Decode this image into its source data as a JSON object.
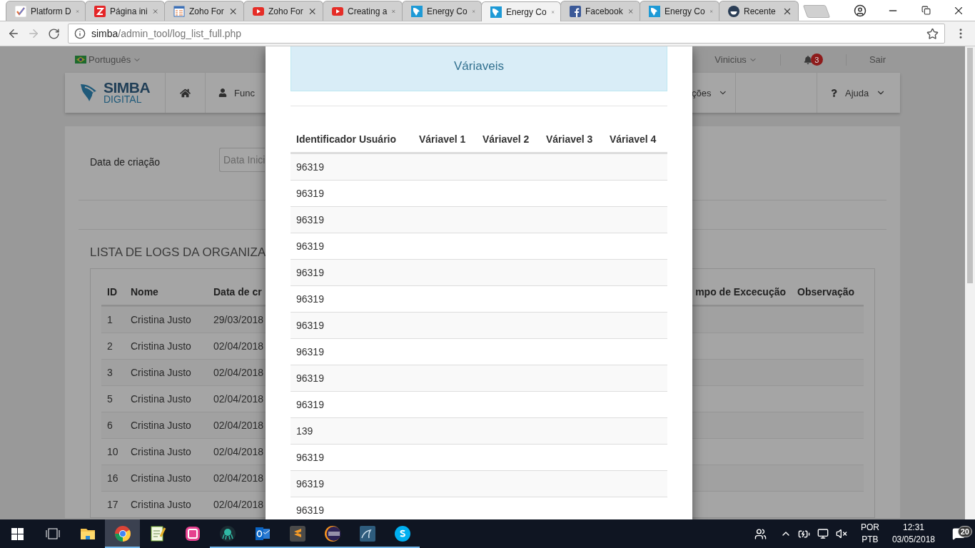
{
  "browser": {
    "tabs": [
      {
        "title": "Platform D",
        "kind": "check",
        "selected": false
      },
      {
        "title": "Página ini",
        "kind": "zoho",
        "selected": false
      },
      {
        "title": "Zoho For",
        "kind": "form",
        "selected": false
      },
      {
        "title": "Zoho For",
        "kind": "youtube",
        "selected": false
      },
      {
        "title": "Creating a",
        "kind": "youtube",
        "selected": false
      },
      {
        "title": "Energy Co",
        "kind": "lion",
        "selected": false
      },
      {
        "title": "Energy Co",
        "kind": "lion",
        "selected": true
      },
      {
        "title": "Facebook",
        "kind": "facebook",
        "selected": false
      },
      {
        "title": "Energy Co",
        "kind": "lion",
        "selected": false
      },
      {
        "title": "Recente",
        "kind": "steam",
        "selected": false
      }
    ],
    "address": {
      "host": "simba",
      "path": "/admin_tool/log_list_full.php"
    }
  },
  "page": {
    "top_bar": {
      "language": "Português",
      "user": "Vinicius",
      "notification_count": "3",
      "logout": "Sair"
    },
    "nav": {
      "logo": {
        "line1": "SIMBA",
        "line2": "DIGITAL"
      },
      "items": [
        {
          "kind": "home"
        },
        {
          "kind": "user",
          "label": "Func"
        }
      ],
      "right_items": [
        {
          "kind": "dropdown",
          "label": "ções"
        },
        {
          "kind": "help",
          "label": "Ajuda"
        }
      ]
    },
    "filter": {
      "label": "Data de criação",
      "start_date": {
        "placeholder": "Data Inici"
      }
    },
    "logs": {
      "title": "LISTA DE LOGS DA ORGANIZA",
      "columns": [
        "ID",
        "Nome",
        "Data de cr",
        "mpo de Excecução",
        "Observação"
      ],
      "rows": [
        [
          "1",
          "Cristina Justo",
          "29/03/2018"
        ],
        [
          "2",
          "Cristina Justo",
          "02/04/2018"
        ],
        [
          "3",
          "Cristina Justo",
          "02/04/2018"
        ],
        [
          "5",
          "Cristina Justo",
          "02/04/2018"
        ],
        [
          "6",
          "Cristina Justo",
          "02/04/2018"
        ],
        [
          "10",
          "Cristina Justo",
          "02/04/2018"
        ],
        [
          "16",
          "Cristina Justo",
          "02/04/2018"
        ],
        [
          "17",
          "Cristina Justo",
          "02/04/2018"
        ]
      ]
    }
  },
  "modal": {
    "panel_title": "Váriaveis",
    "columns": [
      "Identificador Usuário",
      "Váriavel 1",
      "Váriavel 2",
      "Váriavel 3",
      "Váriavel 4"
    ],
    "rows": [
      {
        "user_id": "96319"
      },
      {
        "user_id": "96319"
      },
      {
        "user_id": "96319"
      },
      {
        "user_id": "96319"
      },
      {
        "user_id": "96319"
      },
      {
        "user_id": "96319"
      },
      {
        "user_id": "96319"
      },
      {
        "user_id": "96319"
      },
      {
        "user_id": "96319"
      },
      {
        "user_id": "96319"
      },
      {
        "user_id": "139"
      },
      {
        "user_id": "96319"
      },
      {
        "user_id": "96319"
      },
      {
        "user_id": "96319"
      }
    ]
  },
  "taskbar": {
    "apps": [
      {
        "kind": "explorer",
        "running": false,
        "active": false
      },
      {
        "kind": "chrome",
        "running": true,
        "active": true
      },
      {
        "kind": "notepad",
        "running": false,
        "active": false
      },
      {
        "kind": "wamp",
        "running": false,
        "active": false
      },
      {
        "kind": "gitkraken",
        "running": true,
        "active": false
      },
      {
        "kind": "outlook",
        "running": true,
        "active": false
      },
      {
        "kind": "sublime",
        "running": true,
        "active": false
      },
      {
        "kind": "eclipse",
        "running": true,
        "active": false
      },
      {
        "kind": "workbench",
        "running": true,
        "active": false
      },
      {
        "kind": "skype",
        "running": true,
        "active": false
      }
    ],
    "tray": {
      "language": "POR",
      "layout": "PTB",
      "time": "12:31",
      "date": "03/05/2018",
      "notification_count": "20"
    }
  }
}
